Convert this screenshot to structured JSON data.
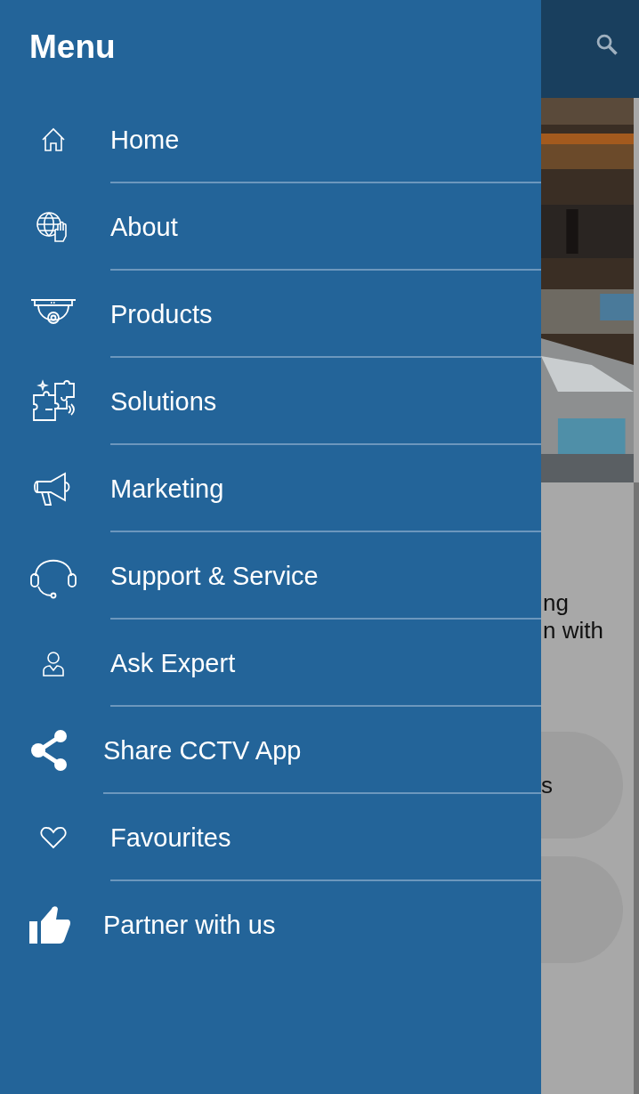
{
  "drawer": {
    "title": "Menu",
    "items": [
      {
        "label": "Home",
        "kind": "outline"
      },
      {
        "label": "About",
        "kind": "outline"
      },
      {
        "label": "Products",
        "kind": "outline"
      },
      {
        "label": "Solutions",
        "kind": "outline"
      },
      {
        "label": "Marketing",
        "kind": "outline"
      },
      {
        "label": "Support & Service",
        "kind": "outline"
      },
      {
        "label": "Ask Expert",
        "kind": "outline"
      },
      {
        "label": "Share CCTV App",
        "kind": "solid"
      },
      {
        "label": "Favourites",
        "kind": "outline"
      },
      {
        "label": "Partner with us",
        "kind": "solid"
      }
    ]
  },
  "background": {
    "hero": {
      "kind": "picture"
    },
    "text_lines": [
      "ng",
      "n with"
    ],
    "buttons": [
      "s"
    ]
  }
}
